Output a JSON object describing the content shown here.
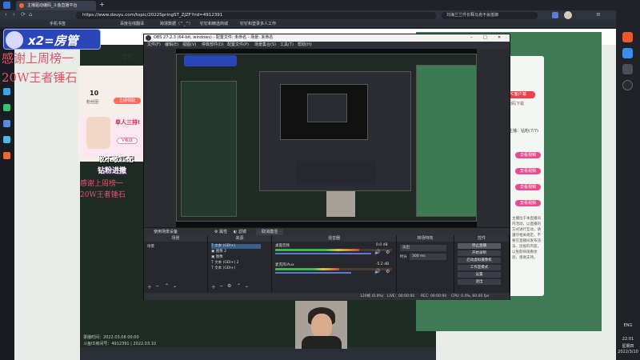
{
  "browser": {
    "tabs": [
      {
        "label": "主播驱动编码_斗鱼直播平台"
      }
    ],
    "url": "https://www.douyu.com/topic/2022SpringST_ZJZF?rid=4912391",
    "search_box_text": "刘海兰兰件长释马克不会抵御",
    "bookmarks": [
      "手机书签",
      "百度在线翻译",
      "跨境数据（^_^）",
      "钉钉和精选商城",
      "钉钉和登录多人工作"
    ]
  },
  "page": {
    "logo_text": "x2=房管",
    "overlay_line1": "感谢上周榜一",
    "overlay_line2": "20W王者锤石",
    "overlay_small_line1": "感谢上周榜一",
    "overlay_small_line2": "20W王者锤石",
    "nav_home": "首页",
    "level_number": "10",
    "level_button": "立即领取",
    "level_label": "粉丝团",
    "duel_title": "单人三排!",
    "duel_button": "V我战",
    "banner_text": "敢不敢匹配",
    "banner_sub": "钻粉进撒",
    "footer_line1": "录播时间：2022.03.08 00:00",
    "footer_line2": "斗鱼ID房间号：4912391 | 2022.03.10",
    "right_badge": "PC客户端",
    "right_link": "扫码下载",
    "right_text_1": "主播：钻粉(7/7)",
    "right_paragraph": "主播位于本直播间内活动，以直播的方式进行互动，请遵守相关规定，不要在直播间发布违法、违规的内容，以免影响观看体验，感谢支持。",
    "right_pills": [
      "去看视频",
      "去看视频",
      "去看视频",
      "去看视频"
    ],
    "right_mascot_text": "超有"
  },
  "obs": {
    "title": "OBS 27.2.3 (64-bit, windows) - 配置文件: 未命名 - 场景: 未命名",
    "menu": [
      "文件(F)",
      "编辑(E)",
      "视图(V)",
      "停靠部件(D)",
      "配置文件(P)",
      "场景集合(S)",
      "工具(T)",
      "帮助(H)"
    ],
    "toolbar": {
      "selection": "使用场景设备",
      "properties": "属性",
      "filters": "滤镜",
      "deactivate": "取消激活"
    },
    "docks": {
      "scenes": {
        "header": "场景",
        "items": [
          "场景"
        ]
      },
      "sources": {
        "header": "来源",
        "items": [
          "文本 (GDI+)",
          "图像 2",
          "图像",
          "文本 (GDI+) 2",
          "文本 (GDI+)"
        ]
      },
      "mixer": {
        "header": "混音器",
        "tracks": [
          {
            "name": "桌面音频 ",
            "db": "0.0 dB",
            "level": 0.72
          },
          {
            "name": "麦克风/Aux",
            "db": "-5.2 dB",
            "level": 0.55
          }
        ]
      },
      "transitions": {
        "header": "转场特效",
        "type": "淡出",
        "duration_label": "时长",
        "duration": "300 ms"
      },
      "controls": {
        "header": "控件",
        "buttons": [
          "停止直播",
          "开始录制",
          "启动虚拟摄像机",
          "工作室模式",
          "设置",
          "退出"
        ]
      }
    },
    "status": {
      "live_label": "LIVE:",
      "live_time": "00:00:00",
      "rec_label": "REC:",
      "rec_time": "00:00:00",
      "cpu": "CPU: 0.4%, 60.00 fps",
      "dropped": "120帧 (0.0%)"
    }
  },
  "taskbar": {
    "lang": "ENG",
    "time": "22:01",
    "day": "星期四",
    "date": "2022/3/10"
  },
  "colors": {
    "obs_bg": "#2a2c31",
    "accent_green": "#3e7a55",
    "overlay_red": "#e0546c",
    "pink_pill": "#e94b8e",
    "selection_blue": "#3b5f8c"
  }
}
